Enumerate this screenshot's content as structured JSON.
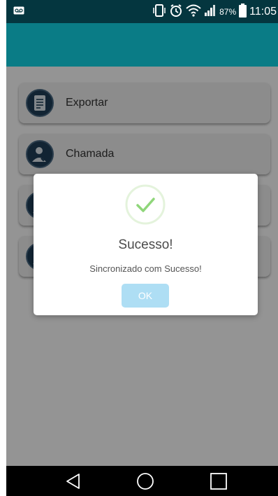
{
  "status_bar": {
    "time": "11:05",
    "battery_percent": "87%",
    "icons": [
      "voicemail-icon",
      "vibrate-icon",
      "alarm-icon",
      "wifi-icon",
      "signal-icon",
      "battery-icon"
    ]
  },
  "menu": {
    "items": [
      {
        "label": "Exportar",
        "icon": "document-icon"
      },
      {
        "label": "Chamada",
        "icon": "user-check-icon"
      },
      {
        "label": "",
        "icon": "user-icon"
      },
      {
        "label": "",
        "icon": "user-icon"
      }
    ]
  },
  "dialog": {
    "title": "Sucesso!",
    "message": "Sincronizado com Sucesso!",
    "ok_label": "OK"
  },
  "nav_bar": {
    "icons": [
      "back-icon",
      "home-icon",
      "recents-icon"
    ]
  },
  "colors": {
    "status_bar": "#04363f",
    "app_bar": "#0a7c86",
    "success_green": "#8fd67a",
    "ok_button": "#aedef4",
    "icon_circle": "#1f3f59"
  }
}
